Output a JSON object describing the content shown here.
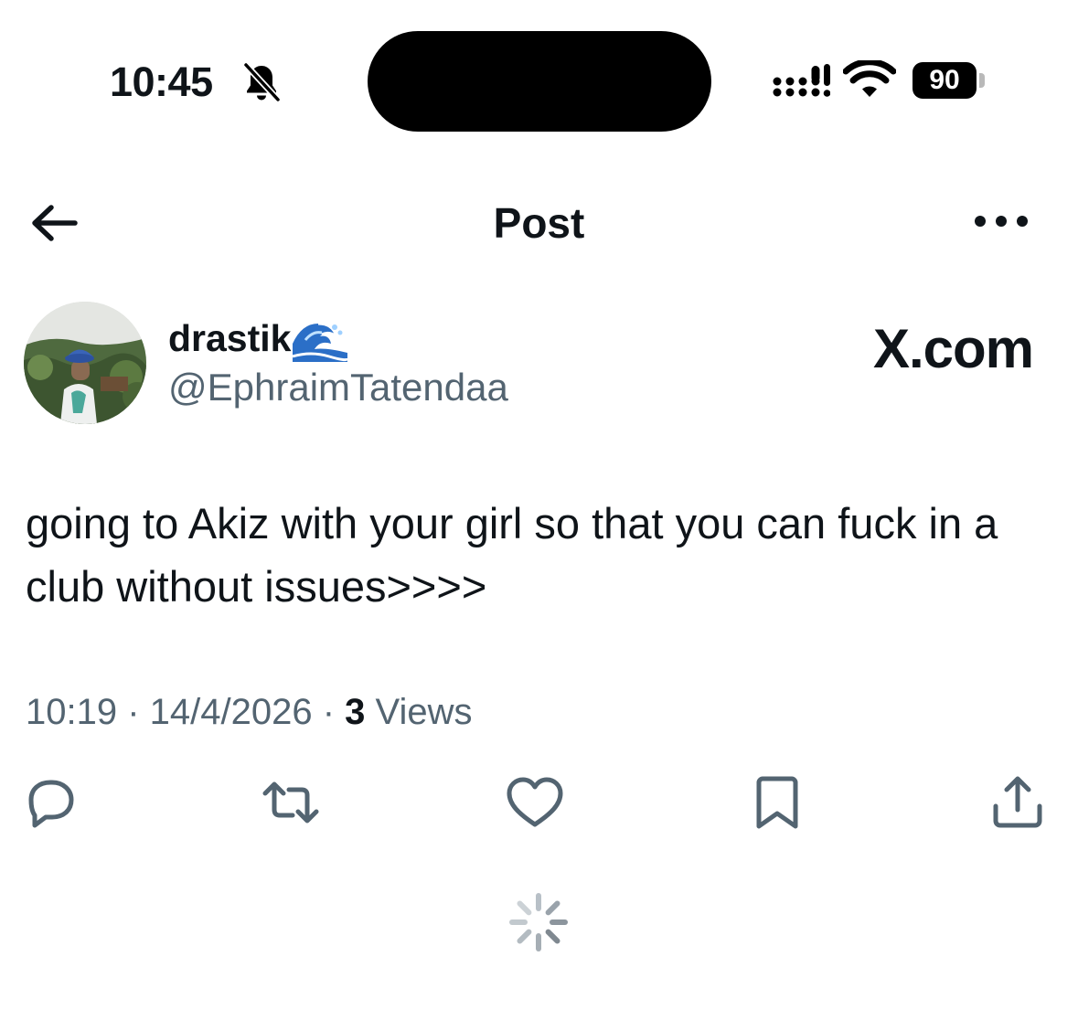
{
  "status_bar": {
    "time": "10:45",
    "battery": "90",
    "icons": [
      "bell-slash-icon",
      "signal-icon",
      "wifi-icon",
      "battery-icon"
    ]
  },
  "header": {
    "title": "Post",
    "back_icon": "arrow-left-icon",
    "more_icon": "more-horizontal-icon"
  },
  "post": {
    "author": {
      "display_name": "drastik",
      "emoji": "wave-emoji",
      "handle": "@EphraimTatendaa"
    },
    "watermark": "X.com",
    "text": "going to Akiz with your girl so that you can fuck in a club without issues>>>>",
    "timestamp": "10:19 · 14/4/2026 · ",
    "views_count": "3",
    "views_label": " Views"
  },
  "actions": [
    {
      "name": "reply",
      "icon": "reply-icon"
    },
    {
      "name": "repost",
      "icon": "repost-icon"
    },
    {
      "name": "like",
      "icon": "heart-icon"
    },
    {
      "name": "bookmark",
      "icon": "bookmark-icon"
    },
    {
      "name": "share",
      "icon": "share-icon"
    }
  ],
  "loading": {
    "icon": "spinner-icon"
  },
  "colors": {
    "text": "#0f1419",
    "secondary": "#536471",
    "background": "#ffffff"
  }
}
